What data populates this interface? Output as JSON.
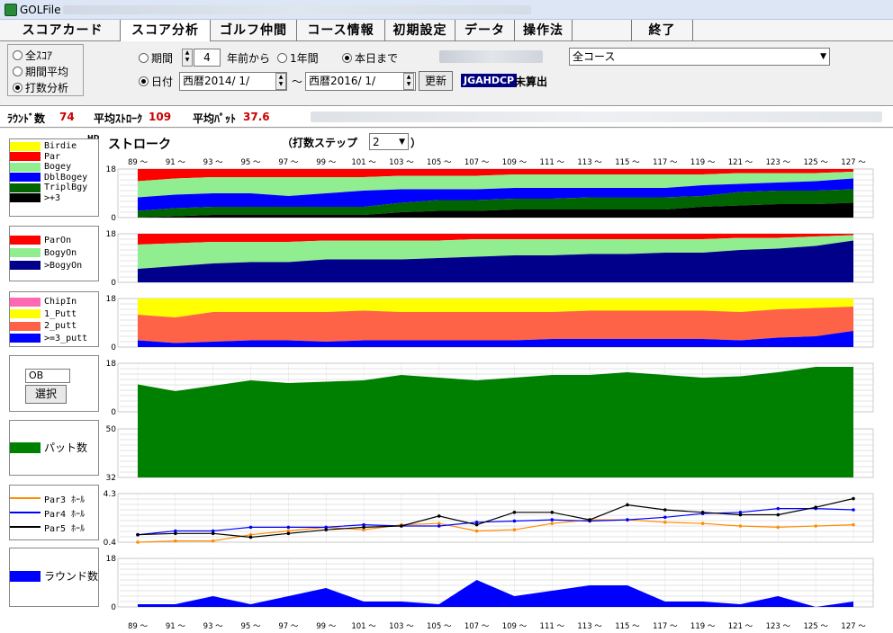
{
  "window": {
    "title": "GOLFile"
  },
  "tabs": [
    {
      "label": "スコアカード",
      "active": false
    },
    {
      "label": "スコア分析",
      "active": true
    },
    {
      "label": "ゴルフ仲間",
      "active": false
    },
    {
      "label": "コース情報",
      "active": false
    },
    {
      "label": "初期設定",
      "active": false
    },
    {
      "label": "データ",
      "active": false
    },
    {
      "label": "操作法",
      "active": false
    },
    {
      "label": "",
      "active": false
    },
    {
      "label": "終了",
      "active": false
    }
  ],
  "mode": {
    "all_score": "全ｽｺｱ",
    "period_avg": "期間平均",
    "stroke_analysis": "打数分析",
    "selected": "stroke_analysis"
  },
  "period": {
    "label": "期間",
    "years_value": "4",
    "years_suffix": "年前から",
    "one_year": "1年間",
    "until_today": "本日まで"
  },
  "date": {
    "label": "日付",
    "from": "西暦2014/ 1/",
    "sep": "～",
    "to": "西暦2016/ 1/",
    "update_btn": "更新"
  },
  "handicap": {
    "label": "JGAHDCP",
    "value": "未算出"
  },
  "course_select": {
    "value": "全コース"
  },
  "stats": {
    "rounds_label": "ﾗｳﾝﾄﾞ数",
    "rounds": "74",
    "avg_stroke_label": "平均ｽﾄﾛｰｸ",
    "avg_stroke": "109",
    "avg_putt_label": "平均ﾊﾟｯﾄ",
    "avg_putt": "37.6"
  },
  "analysis": {
    "title": "ストローク",
    "step_label": "（打数ステップ",
    "step_value": "2",
    "step_close": "）",
    "hd_label": "HD",
    "x_ticks": [
      "89 ～",
      "91 ～",
      "93 ～",
      "95 ～",
      "97 ～",
      "99 ～",
      "101 ～",
      "103 ～",
      "105 ～",
      "107 ～",
      "109 ～",
      "111 ～",
      "113 ～",
      "115 ～",
      "117 ～",
      "119 ～",
      "121 ～",
      "123 ～",
      "125 ～",
      "127 ～"
    ]
  },
  "ob": {
    "input_value": "OB",
    "select_btn": "選択"
  },
  "colors": {
    "birdie": "#ffff00",
    "par": "#ff0000",
    "bogey": "#90ee90",
    "dblbogey": "#0000ff",
    "tripl": "#006400",
    "plus3": "#000000",
    "paron": "#ff0000",
    "bogyon": "#90ee90",
    "bogeyon_over": "#00008b",
    "chipin": "#ff69b4",
    "putt1": "#ffff00",
    "putt2": "#ff6347",
    "putt3": "#0000ff",
    "ob": "#00008b",
    "putts": "#008000",
    "par3": "#ff8c00",
    "par4": "#0000ff",
    "par5": "#000000",
    "rounds": "#0000ff"
  },
  "chart_data": [
    {
      "type": "area",
      "id": "score_dist",
      "ylim": [
        0,
        18
      ],
      "yticks": [
        "18",
        "0"
      ],
      "series": [
        {
          "name": "Birdie",
          "values": [
            0,
            0,
            0,
            0,
            0,
            0,
            0,
            0,
            0,
            0,
            0,
            0,
            0,
            0,
            0,
            0,
            0,
            0,
            0,
            0
          ]
        },
        {
          "name": "Par",
          "values": [
            4.5,
            3.5,
            3.0,
            3.0,
            3.0,
            3.0,
            3.0,
            2.5,
            2.5,
            2.5,
            2.0,
            2.0,
            2.0,
            2.0,
            2.0,
            2.0,
            1.5,
            1.5,
            1.5,
            1.0
          ]
        },
        {
          "name": "Bogey",
          "values": [
            6,
            6,
            6,
            6,
            7,
            6,
            5,
            5,
            5,
            5,
            5,
            5,
            5,
            5,
            5,
            4,
            4,
            3.5,
            3,
            2.5
          ]
        },
        {
          "name": "DblBogey",
          "values": [
            5,
            5,
            5,
            5,
            4,
            5,
            6,
            5,
            4,
            4,
            4,
            4,
            3.5,
            3.5,
            3.5,
            4,
            3,
            3,
            3.5,
            4
          ]
        },
        {
          "name": "TriplBgy",
          "values": [
            2.5,
            3,
            3,
            3,
            3,
            3,
            3,
            3.5,
            4,
            4,
            4,
            4,
            4.5,
            4.5,
            4.5,
            4,
            5,
            5,
            5,
            5
          ]
        },
        {
          "name": ">+3",
          "values": [
            0,
            0.5,
            1,
            1,
            1,
            1,
            1,
            2,
            2.5,
            2.5,
            3,
            3,
            3,
            3,
            3,
            4,
            4.5,
            5,
            5,
            5.5
          ]
        }
      ]
    },
    {
      "type": "area",
      "id": "on_dist",
      "ylim": [
        0,
        18
      ],
      "yticks": [
        "18",
        "0"
      ],
      "series": [
        {
          "name": "ParOn",
          "values": [
            4,
            3.5,
            3,
            3,
            3,
            2.5,
            2.5,
            2.5,
            2.5,
            2,
            2,
            2,
            2,
            2,
            2,
            2,
            1.5,
            1.5,
            1,
            0.5
          ]
        },
        {
          "name": "BogyOn",
          "values": [
            9,
            8.5,
            8,
            7.5,
            7.5,
            7,
            7,
            7,
            6.5,
            6.5,
            6,
            6,
            5.5,
            5.5,
            5,
            5,
            4.5,
            4,
            3.5,
            2
          ]
        },
        {
          "name": ">BogyOn",
          "values": [
            5,
            6,
            7,
            7.5,
            7.5,
            8.5,
            8.5,
            8.5,
            9,
            9.5,
            10,
            10,
            10.5,
            10.5,
            11,
            11,
            12,
            12.5,
            13.5,
            15.5
          ]
        }
      ]
    },
    {
      "type": "area",
      "id": "putt_dist",
      "ylim": [
        0,
        18
      ],
      "yticks": [
        "18",
        "0"
      ],
      "series": [
        {
          "name": "ChipIn",
          "values": [
            0,
            0,
            0,
            0,
            0,
            0,
            0,
            0,
            0,
            0,
            0,
            0,
            0,
            0,
            0,
            0,
            0,
            0,
            0,
            0
          ]
        },
        {
          "name": "1_Putt",
          "values": [
            6,
            7,
            5,
            5,
            5,
            5,
            4.5,
            5,
            5,
            5,
            5,
            5,
            4.5,
            4.5,
            4.5,
            4.5,
            5,
            4,
            3.5,
            3
          ]
        },
        {
          "name": "2_putt",
          "values": [
            9.5,
            9.5,
            11,
            10.5,
            10.5,
            11,
            11,
            10.5,
            10.5,
            10.5,
            10.5,
            10,
            10.5,
            10.5,
            10.5,
            10.5,
            10.5,
            10.5,
            10.5,
            9
          ]
        },
        {
          "name": ">=3_putt",
          "values": [
            2.5,
            1.5,
            2,
            2.5,
            2.5,
            2,
            2.5,
            2.5,
            2.5,
            2.5,
            2.5,
            3,
            3,
            3,
            3,
            3,
            2.5,
            3.5,
            4,
            6
          ]
        }
      ]
    },
    {
      "type": "area",
      "id": "ob_chart",
      "ylim": [
        0,
        18
      ],
      "yticks": [
        "18",
        "0"
      ],
      "series": [
        {
          "name": "OB",
          "values": [
            0,
            0,
            0,
            0.6,
            0.9,
            1.2,
            1.5,
            1.7,
            1.9,
            2.1,
            1.5,
            1.2,
            1.0,
            0.9,
            0.8,
            0.9,
            0,
            0,
            0,
            0
          ]
        }
      ]
    },
    {
      "type": "area",
      "id": "putts_chart",
      "ylim": [
        32,
        50
      ],
      "yticks": [
        "50",
        "32"
      ],
      "series": [
        {
          "name": "パット数",
          "values": [
            34.5,
            32,
            34,
            36,
            35,
            35.5,
            36,
            38,
            37,
            36,
            37,
            38,
            38,
            39,
            38,
            37,
            37.5,
            39,
            41,
            41
          ]
        }
      ]
    },
    {
      "type": "line",
      "id": "par_avg",
      "ylim": [
        0.4,
        4.3
      ],
      "yticks": [
        "4.3",
        "0.4"
      ],
      "series": [
        {
          "name": "Par3 ﾎｰﾙ",
          "values": [
            0.4,
            0.5,
            0.5,
            1.0,
            1.3,
            1.6,
            1.4,
            1.8,
            1.9,
            1.3,
            1.4,
            1.9,
            2.2,
            2.2,
            2.0,
            1.9,
            1.7,
            1.6,
            1.7,
            1.8
          ]
        },
        {
          "name": "Par4 ﾎｰﾙ",
          "values": [
            1.0,
            1.3,
            1.3,
            1.6,
            1.6,
            1.6,
            1.8,
            1.7,
            1.7,
            2.0,
            2.1,
            2.2,
            2.1,
            2.2,
            2.4,
            2.7,
            2.8,
            3.1,
            3.1,
            3.0
          ]
        },
        {
          "name": "Par5 ﾎｰﾙ",
          "values": [
            1.0,
            1.1,
            1.1,
            0.8,
            1.1,
            1.4,
            1.6,
            1.7,
            2.5,
            1.8,
            2.8,
            2.8,
            2.2,
            3.4,
            3.0,
            2.8,
            2.6,
            2.6,
            3.2,
            3.9
          ]
        }
      ]
    },
    {
      "type": "area",
      "id": "rounds_chart",
      "ylim": [
        0,
        18
      ],
      "yticks": [
        "18",
        "0"
      ],
      "series": [
        {
          "name": "ラウンド数",
          "values": [
            1,
            1,
            4,
            1,
            4,
            7,
            2,
            2,
            1,
            10,
            4,
            6,
            8,
            8,
            2,
            2,
            1,
            4,
            0,
            2
          ]
        }
      ]
    }
  ]
}
